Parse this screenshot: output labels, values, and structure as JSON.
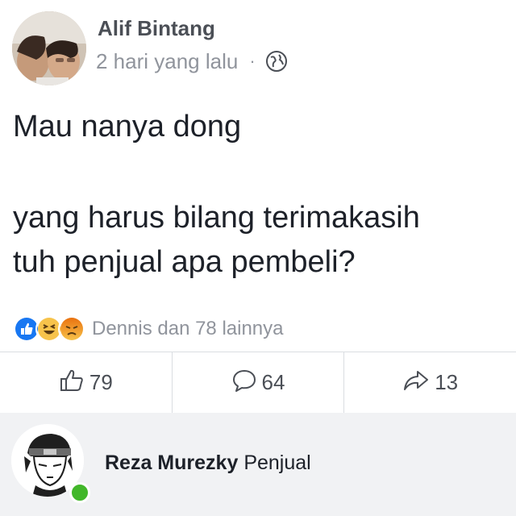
{
  "post": {
    "author": "Alif Bintang",
    "timestamp": "2 hari yang lalu",
    "separator": "·",
    "privacy_icon": "globe-icon",
    "lines": [
      "Mau nanya dong",
      "yang harus bilang terimakasih",
      "tuh penjual apa pembeli?"
    ]
  },
  "reactions": {
    "icons": [
      "like-icon",
      "haha-icon",
      "angry-icon"
    ],
    "summary": "Dennis dan 78 lainnya"
  },
  "actions": {
    "like_count": "79",
    "comment_count": "64",
    "share_count": "13"
  },
  "comment": {
    "author": "Reza Murezky",
    "text": "Penjual",
    "online": true
  },
  "colors": {
    "like_blue": "#1877f2",
    "haha_yellow": "#f7c34b",
    "angry_orange": "#e9710f",
    "online_green": "#42b72a"
  }
}
